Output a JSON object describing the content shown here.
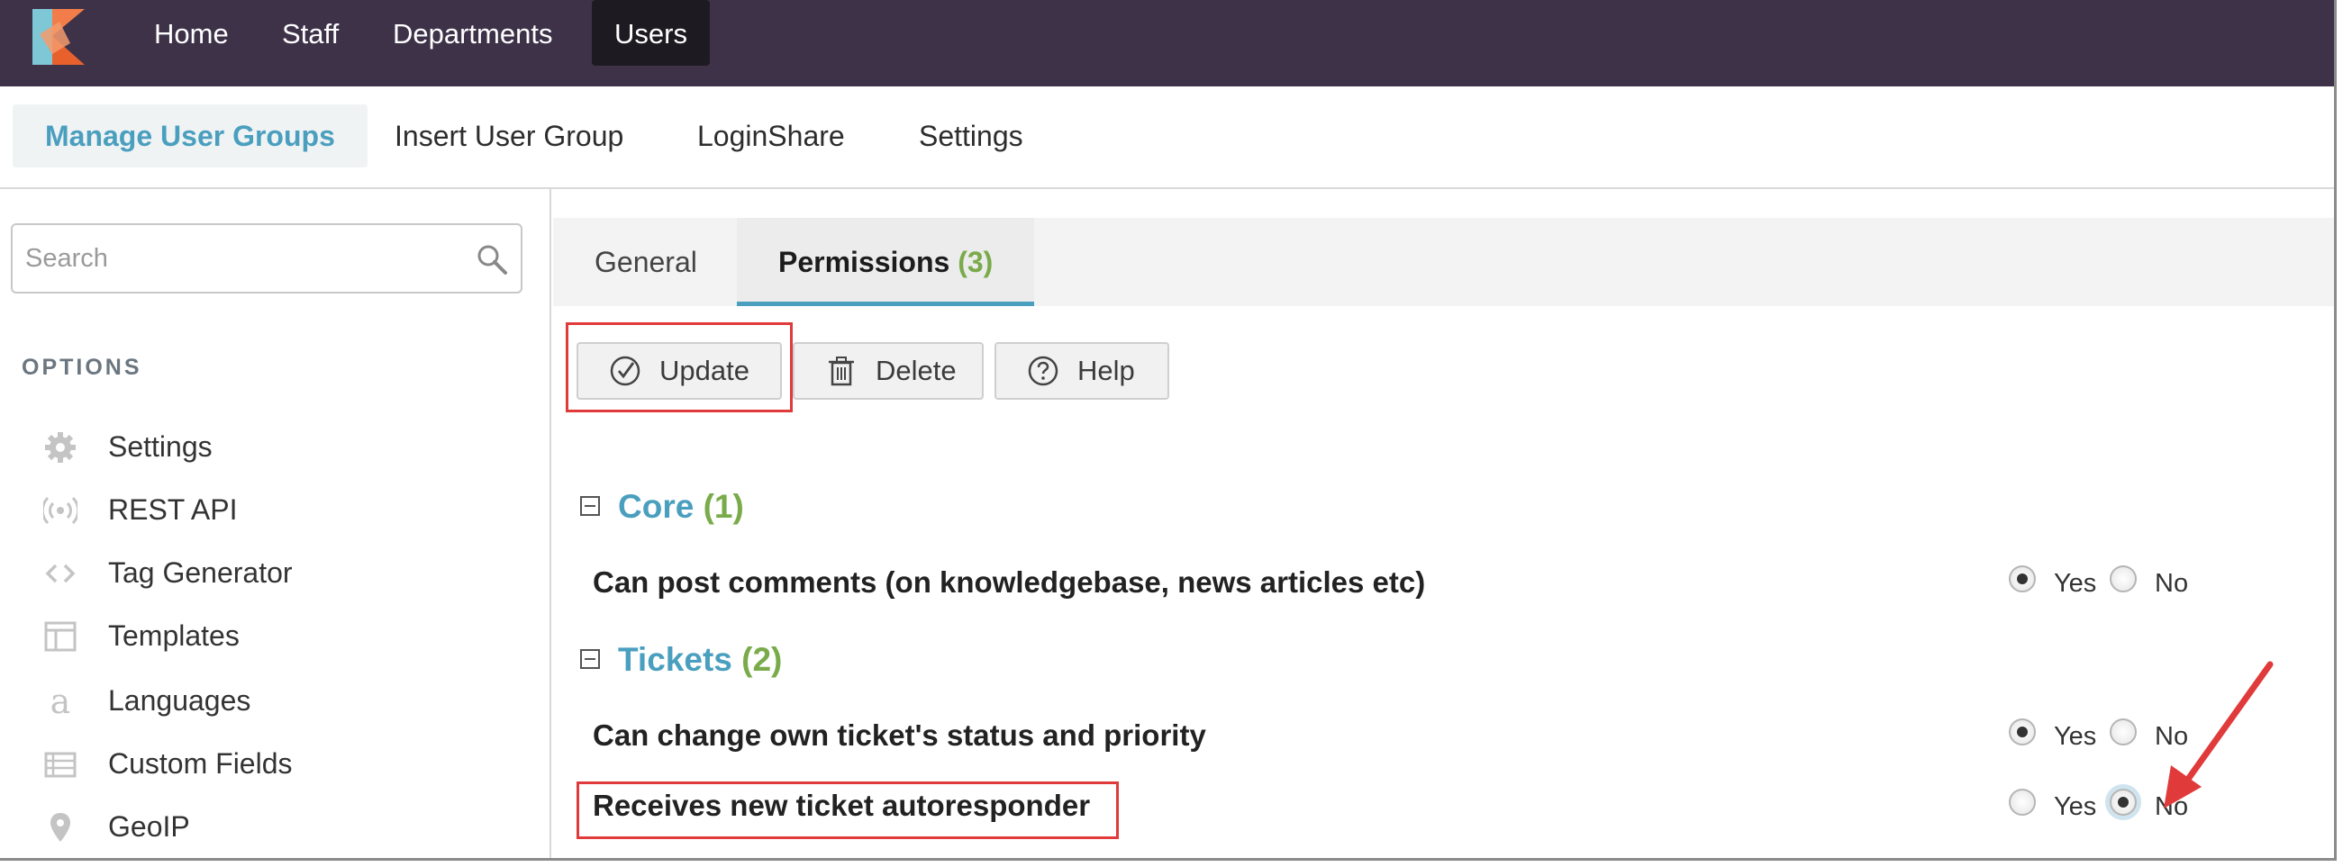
{
  "topnav": {
    "items": [
      {
        "label": "Home",
        "active": false
      },
      {
        "label": "Staff",
        "active": false
      },
      {
        "label": "Departments",
        "active": false
      },
      {
        "label": "Users",
        "active": true
      }
    ]
  },
  "subnav": {
    "items": [
      {
        "label": "Manage User Groups",
        "active": true
      },
      {
        "label": "Insert User Group",
        "active": false
      },
      {
        "label": "LoginShare",
        "active": false
      },
      {
        "label": "Settings",
        "active": false
      }
    ]
  },
  "sidebar": {
    "search_placeholder": "Search",
    "options_heading": "OPTIONS",
    "items": [
      {
        "label": "Settings",
        "icon": "gear-icon"
      },
      {
        "label": "REST API",
        "icon": "broadcast-icon"
      },
      {
        "label": "Tag Generator",
        "icon": "code-icon"
      },
      {
        "label": "Templates",
        "icon": "template-icon"
      },
      {
        "label": "Languages",
        "icon": "language-icon"
      },
      {
        "label": "Custom Fields",
        "icon": "list-icon"
      },
      {
        "label": "GeoIP",
        "icon": "map-pin-icon"
      }
    ]
  },
  "tabs": {
    "general": "General",
    "permissions": "Permissions",
    "permissions_count": "(3)"
  },
  "toolbar": {
    "update": "Update",
    "delete": "Delete",
    "help": "Help"
  },
  "sections": {
    "core": {
      "title": "Core",
      "count": "(1)",
      "rows": [
        {
          "label": "Can post comments (on knowledgebase, news articles etc)",
          "value": "Yes"
        }
      ]
    },
    "tickets": {
      "title": "Tickets",
      "count": "(2)",
      "rows": [
        {
          "label": "Can change own ticket's status and priority",
          "value": "Yes"
        },
        {
          "label": "Receives new ticket autoresponder",
          "value": "No"
        }
      ]
    }
  },
  "radio_labels": {
    "yes": "Yes",
    "no": "No"
  },
  "colors": {
    "topnav_bg": "#3e3249",
    "accent": "#4a9fbf",
    "count_green": "#7aab4a",
    "highlight_red": "#e03a3a"
  }
}
